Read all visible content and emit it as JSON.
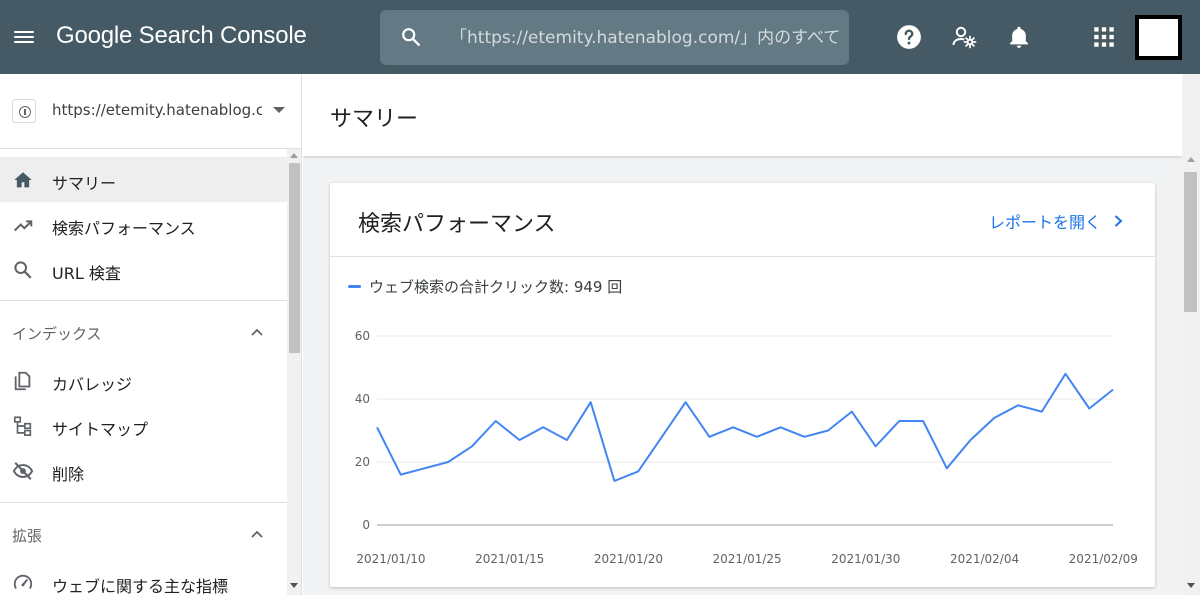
{
  "colors": {
    "topbar": "#455a64",
    "search_bg": "#637983",
    "accent": "#1a73e8",
    "series": "#4285f4",
    "active_nav": "#eeeeee"
  },
  "header": {
    "menu_icon": "menu-icon",
    "app_title": "Google Search Console",
    "search": {
      "placeholder": "「https://etemity.hatenablog.com/」内のすべてのURLを検査",
      "icon": "search-icon"
    },
    "icons": [
      "help-icon",
      "manage-users-icon",
      "notifications-icon",
      "apps-grid-icon"
    ]
  },
  "sidebar": {
    "property": "https://etemity.hatenablog.com/",
    "items": [
      {
        "label": "サマリー",
        "icon": "home-icon",
        "active": true
      },
      {
        "label": "検索パフォーマンス",
        "icon": "trending-up-icon",
        "active": false
      },
      {
        "label": "URL 検査",
        "icon": "search-icon",
        "active": false
      }
    ],
    "sections": [
      {
        "title": "インデックス",
        "items": [
          {
            "label": "カバレッジ",
            "icon": "copy-icon"
          },
          {
            "label": "サイトマップ",
            "icon": "sitemap-icon"
          },
          {
            "label": "削除",
            "icon": "visibility-off-icon"
          }
        ]
      },
      {
        "title": "拡張",
        "items": [
          {
            "label": "ウェブに関する主な指標",
            "icon": "speed-icon"
          }
        ]
      }
    ]
  },
  "main": {
    "page_title": "サマリー",
    "card": {
      "title": "検索パフォーマンス",
      "link": "レポートを開く",
      "legend": "ウェブ検索の合計クリック数: 949 回"
    }
  },
  "chart_data": {
    "type": "line",
    "title": "",
    "xlabel": "",
    "ylabel": "",
    "ylim": [
      0,
      60
    ],
    "yticks": [
      "0",
      "20",
      "40",
      "60"
    ],
    "xticks": [
      "2021/01/10",
      "2021/01/15",
      "2021/01/20",
      "2021/01/25",
      "2021/01/30",
      "2021/02/04",
      "2021/02/09"
    ],
    "grid": true,
    "dates": [
      "2021/01/10",
      "2021/01/11",
      "2021/01/12",
      "2021/01/13",
      "2021/01/14",
      "2021/01/15",
      "2021/01/16",
      "2021/01/17",
      "2021/01/18",
      "2021/01/19",
      "2021/01/20",
      "2021/01/21",
      "2021/01/22",
      "2021/01/23",
      "2021/01/24",
      "2021/01/25",
      "2021/01/26",
      "2021/01/27",
      "2021/01/28",
      "2021/01/29",
      "2021/01/30",
      "2021/01/31",
      "2021/02/01",
      "2021/02/02",
      "2021/02/03",
      "2021/02/04",
      "2021/02/05",
      "2021/02/06",
      "2021/02/07",
      "2021/02/08",
      "2021/02/09"
    ],
    "series": [
      {
        "values": [
          31,
          16,
          18,
          20,
          25,
          33,
          27,
          31,
          27,
          39,
          14,
          17,
          28,
          39,
          28,
          31,
          28,
          31,
          28,
          30,
          36,
          25,
          33,
          33,
          18,
          27,
          34,
          38,
          36,
          48,
          37,
          43
        ]
      }
    ]
  }
}
